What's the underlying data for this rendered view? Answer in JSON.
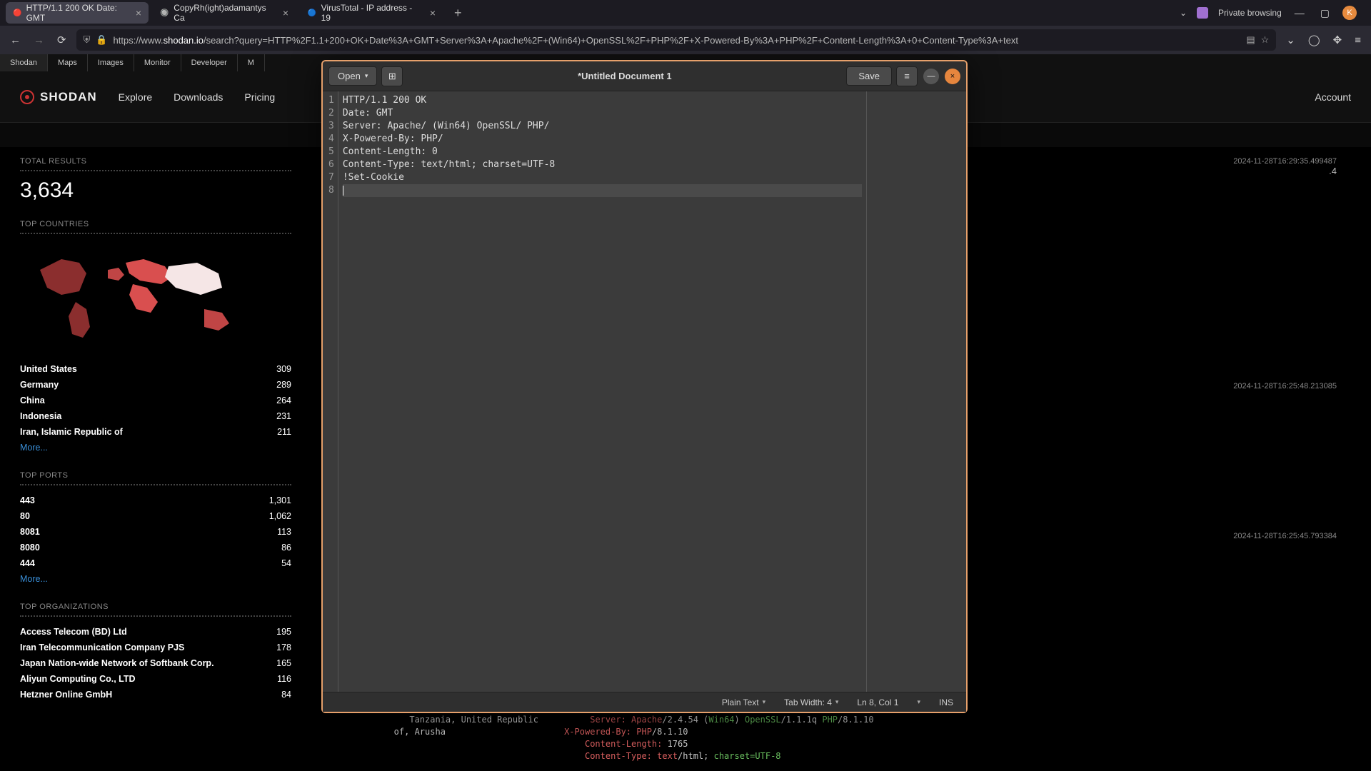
{
  "browser": {
    "tabs": [
      {
        "title": "HTTP/1.1 200 OK Date: GMT",
        "active": true
      },
      {
        "title": "CopyRh(ight)adamantys Ca",
        "active": false
      },
      {
        "title": "VirusTotal - IP address - 19",
        "active": false
      }
    ],
    "private_label": "Private browsing",
    "url_prefix": "https://www.",
    "url_domain": "shodan.io",
    "url_path": "/search?query=HTTP%2F1.1+200+OK+Date%3A+GMT+Server%3A+Apache%2F+(Win64)+OpenSSL%2F+PHP%2F+X-Powered-By%3A+PHP%2F+Content-Length%3A+0+Content-Type%3A+text"
  },
  "thin_nav": [
    "Shodan",
    "Maps",
    "Images",
    "Monitor",
    "Developer",
    "M"
  ],
  "shodan_nav": {
    "brand": "SHODAN",
    "links": [
      "Explore",
      "Downloads",
      "Pricing"
    ],
    "account": "Account"
  },
  "totals": {
    "title": "TOTAL RESULTS",
    "value": "3,634"
  },
  "countries": {
    "title": "TOP COUNTRIES",
    "rows": [
      {
        "name": "United States",
        "value": "309"
      },
      {
        "name": "Germany",
        "value": "289"
      },
      {
        "name": "China",
        "value": "264"
      },
      {
        "name": "Indonesia",
        "value": "231"
      },
      {
        "name": "Iran, Islamic Republic of",
        "value": "211"
      }
    ],
    "more": "More..."
  },
  "ports": {
    "title": "TOP PORTS",
    "rows": [
      {
        "name": "443",
        "value": "1,301"
      },
      {
        "name": "80",
        "value": "1,062"
      },
      {
        "name": "8081",
        "value": "113"
      },
      {
        "name": "8080",
        "value": "86"
      },
      {
        "name": "444",
        "value": "54"
      }
    ],
    "more": "More..."
  },
  "orgs": {
    "title": "TOP ORGANIZATIONS",
    "rows": [
      {
        "name": "Access Telecom (BD) Ltd",
        "value": "195"
      },
      {
        "name": "Iran Telecommunication Company PJS",
        "value": "178"
      },
      {
        "name": "Japan Nation-wide Network of Softbank Corp.",
        "value": "165"
      },
      {
        "name": "Aliyun Computing Co., LTD",
        "value": "116"
      },
      {
        "name": "Hetzner Online GmbH",
        "value": "84"
      }
    ]
  },
  "results_meta": [
    {
      "ts": "2024-11-28T16:29:35.499487",
      "extra": ".4"
    },
    {
      "ts": "2024-11-28T16:25:48.213085"
    },
    {
      "ts": "2024-11-28T16:25:45.793384"
    }
  ],
  "editor": {
    "open": "Open",
    "save": "Save",
    "title": "*Untitled Document 1",
    "lines": [
      "HTTP/1.1 200 OK",
      "Date: GMT",
      "Server: Apache/ (Win64) OpenSSL/ PHP/",
      "X-Powered-By: PHP/",
      "Content-Length: 0",
      "Content-Type: text/html; charset=UTF-8",
      "!Set-Cookie",
      ""
    ],
    "status": {
      "lang": "Plain Text",
      "tab": "Tab Width: 4",
      "pos": "Ln 8, Col 1",
      "ins": "INS"
    }
  },
  "term": {
    "l1_pre": "      Tanzania, United Republic",
    "l2_pre": "   of, Arusha",
    "srv_a": "Server: Apache",
    "srv_b": "/2.4.54 (",
    "srv_c": "Win64",
    "srv_d": ") ",
    "srv_e": "OpenSSL",
    "srv_f": "/1.1.1q ",
    "srv_g": "PHP",
    "srv_h": "/8.1.10",
    "xp_a": "X-Powered-By: PHP",
    "xp_b": "/8.1.10",
    "cl_a": "Content-Length:",
    "cl_b": " 1765",
    "ct_a": "Content-Type: text",
    "ct_b": "/html; ",
    "ct_c": "charset=UTF-8"
  }
}
